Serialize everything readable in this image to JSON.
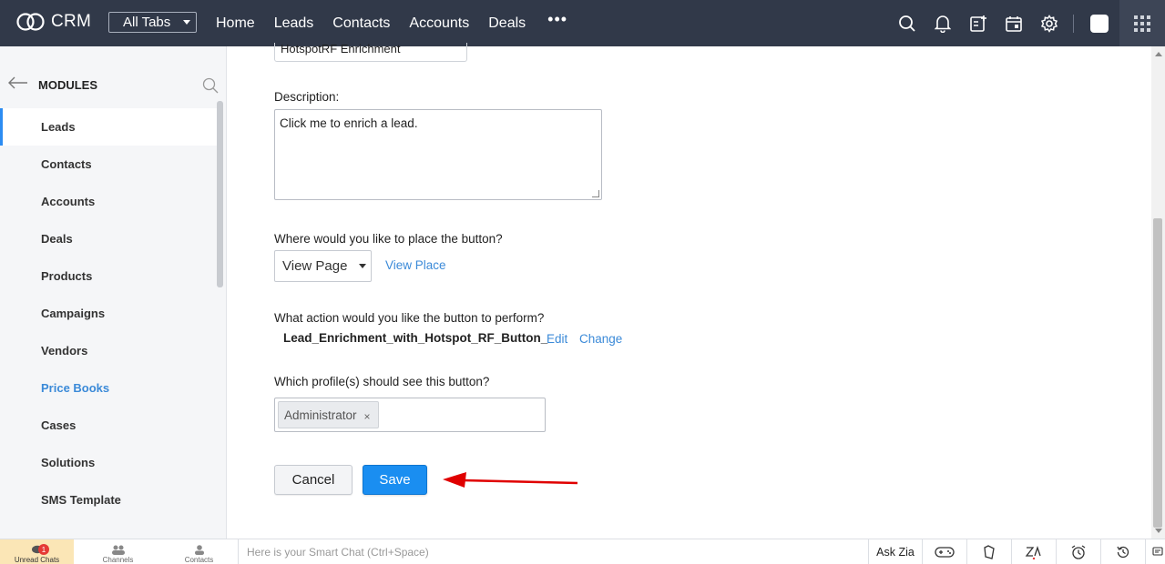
{
  "topbar": {
    "app_name": "CRM",
    "all_tabs": "All Tabs",
    "nav": [
      "Home",
      "Leads",
      "Contacts",
      "Accounts",
      "Deals"
    ],
    "more": "•••",
    "icons": [
      "search-icon",
      "bell-icon",
      "add-note-icon",
      "calendar-icon",
      "gear-icon",
      "avatar",
      "apps-grid-icon"
    ]
  },
  "sidebar": {
    "title": "MODULES",
    "items": [
      {
        "label": "Leads"
      },
      {
        "label": "Contacts"
      },
      {
        "label": "Accounts"
      },
      {
        "label": "Deals"
      },
      {
        "label": "Products"
      },
      {
        "label": "Campaigns"
      },
      {
        "label": "Vendors"
      },
      {
        "label": "Price Books"
      },
      {
        "label": "Cases"
      },
      {
        "label": "Solutions"
      },
      {
        "label": "SMS Template"
      }
    ]
  },
  "form": {
    "name_value": "HotspotRF Enrichment",
    "description_label": "Description:",
    "description_value": "Click me to enrich a lead.",
    "placement_label": "Where would you like to place the button?",
    "placement_value": "View Page",
    "placement_link": "View Place",
    "action_label": "What action would you like the button to perform?",
    "action_value": "Lead_Enrichment_with_Hotspot_RF_Button_",
    "edit_link": "Edit",
    "change_link": "Change",
    "profiles_label": "Which profile(s) should see this button?",
    "profile_chip": "Administrator",
    "chip_remove": "×",
    "cancel": "Cancel",
    "save": "Save"
  },
  "colors": {
    "topbar": "#313949",
    "primary": "#1a8ef1",
    "link": "#3b8ad8",
    "annotation_arrow": "#e00000"
  },
  "bottombar": {
    "unread_chats": "Unread Chats",
    "unread_count": "1",
    "channels": "Channels",
    "contacts": "Contacts",
    "smart_chat_placeholder": "Here is your Smart Chat (Ctrl+Space)",
    "ask_zia": "Ask Zia"
  }
}
